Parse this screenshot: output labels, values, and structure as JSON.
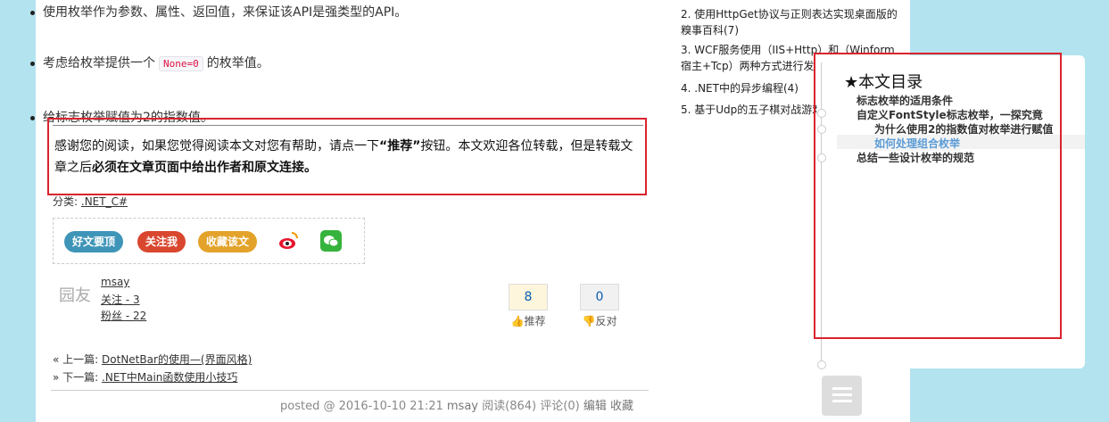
{
  "article": {
    "tips": [
      "使用枚举作为参数、属性、返回值，来保证该API是强类型的API。",
      "考虑给枚举提供一个",
      "给标志枚举赋值为2的指数值。"
    ],
    "tip2_code": "None=0",
    "tip2_tail": "的枚举值。"
  },
  "notice": {
    "part1": "感谢您的阅读，如果您觉得阅读本文对您有帮助，请点一下",
    "recommend": "“推荐”",
    "part2": "按钮。本文欢迎各位转载，但是转载文章之后",
    "bold": "必须在文章页面中给出作者和原文连接。"
  },
  "category": {
    "label": "分类:",
    "value": ".NET_C#"
  },
  "share": {
    "good": "好文要顶",
    "follow": "关注我",
    "fav": "收藏该文"
  },
  "author": {
    "name": "msay",
    "follow": "关注 - 3",
    "fans": "粉丝 - 22",
    "avatar_text": "园友"
  },
  "votes": {
    "up_count": "8",
    "up_label": "推荐",
    "down_count": "0",
    "down_label": "反对"
  },
  "nav": {
    "prev_label": "« 上一篇:",
    "prev_link": "DotNetBar的使用—(界面风格)",
    "next_label": "» 下一篇:",
    "next_link": ".NET中Main函数使用小技巧"
  },
  "postinfo": {
    "posted": "posted @ 2016-10-10 21:21",
    "author": "msay",
    "reads": "阅读(864)",
    "comments": "评论(0)",
    "edit": "编辑",
    "fav": "收藏"
  },
  "sidebar": {
    "items": [
      "2. 使用HttpGet协议与正则表达实现桌面版的糗事百科(7)",
      "3. WCF服务使用（IIS+Http）和（Winform宿主+Tcp）两种方式进行发",
      "4. .NET中的异步编程(4)",
      "5. 基于Udp的五子棋对战游戏"
    ]
  },
  "toc": {
    "title": "★本文目录",
    "items": [
      "标志枚举的适用条件",
      "自定义FontStyle标志枚举，一探究竟",
      "为什么使用2的指数值对枚举进行赋值",
      "如何处理组合枚举",
      "总结一些设计枚举的规范"
    ]
  }
}
